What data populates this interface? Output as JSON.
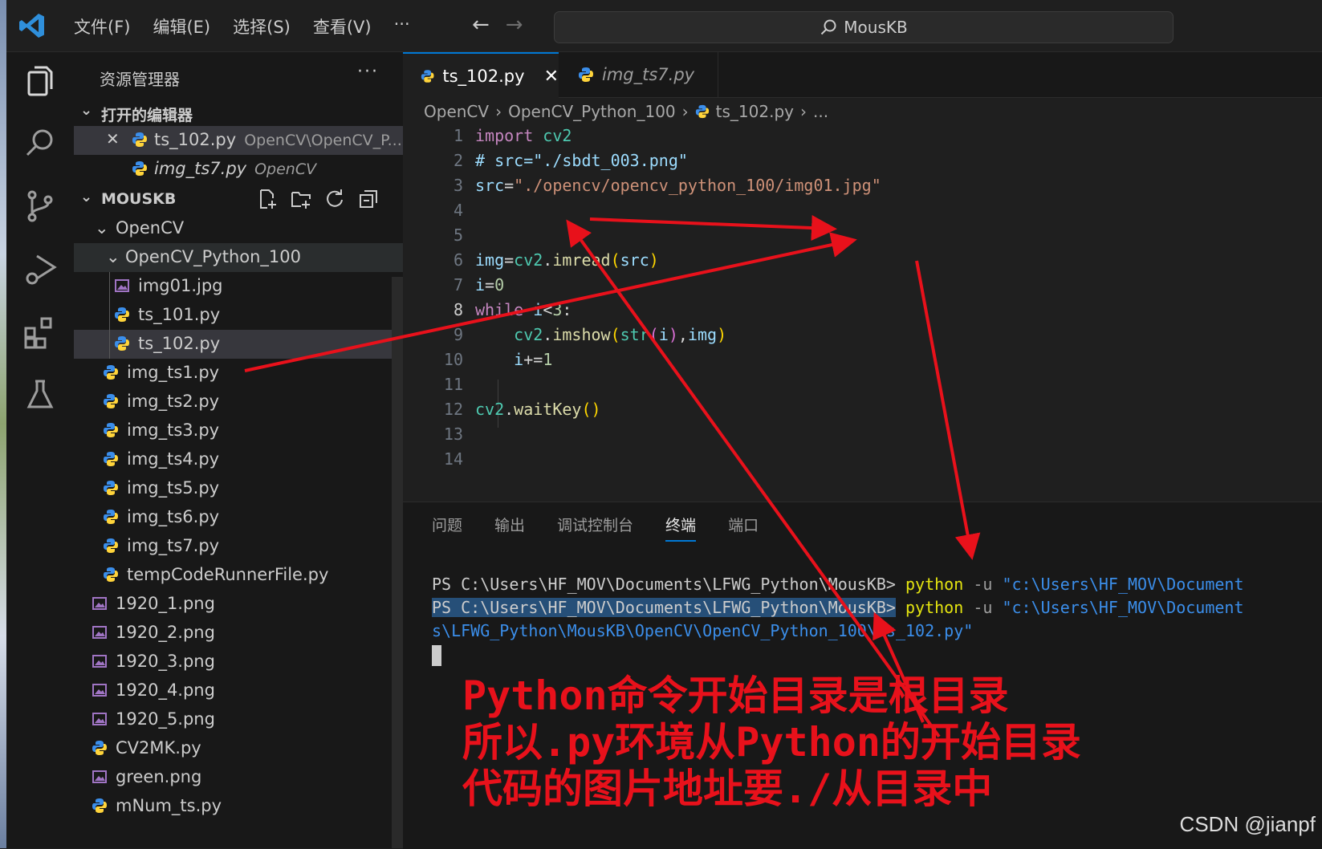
{
  "titlebar": {
    "menu": [
      "文件(F)",
      "编辑(E)",
      "选择(S)",
      "查看(V)",
      "···"
    ],
    "search_text": "MousKB"
  },
  "sidebar": {
    "title": "资源管理器",
    "more": "···",
    "open_editors": {
      "label": "打开的编辑器",
      "items": [
        {
          "name": "ts_102.py",
          "path": "OpenCV\\OpenCV_P..."
        },
        {
          "name": "img_ts7.py",
          "path": "OpenCV"
        }
      ]
    },
    "workspace": {
      "label": "MOUSKB",
      "folders": [
        "OpenCV",
        "OpenCV_Python_100"
      ],
      "files": [
        "img01.jpg",
        "ts_101.py",
        "ts_102.py",
        "img_ts1.py",
        "img_ts2.py",
        "img_ts3.py",
        "img_ts4.py",
        "img_ts5.py",
        "img_ts6.py",
        "img_ts7.py",
        "tempCodeRunnerFile.py",
        "1920_1.png",
        "1920_2.png",
        "1920_3.png",
        "1920_4.png",
        "1920_5.png",
        "CV2MK.py",
        "green.png",
        "mNum_ts.py"
      ]
    }
  },
  "editor": {
    "tabs": [
      {
        "label": "ts_102.py",
        "close": "✕"
      },
      {
        "label": "img_ts7.py"
      }
    ],
    "breadcrumbs": [
      "OpenCV",
      "OpenCV_Python_100",
      "ts_102.py",
      "..."
    ],
    "line_numbers": [
      "1",
      "2",
      "3",
      "4",
      "5",
      "6",
      "7",
      "8",
      "9",
      "10",
      "11",
      "12",
      "13",
      "14"
    ]
  },
  "panel": {
    "tabs": [
      "问题",
      "输出",
      "调试控制台",
      "终端",
      "端口"
    ],
    "terminal": {
      "prompt": "PS C:\\Users\\HF_MOV\\Documents\\LFWG_Python\\MousKB>",
      "cmd": "python",
      "opt": "-u",
      "arg1": "\"c:\\Users\\HF_MOV\\Document",
      "arg2": "s\\LFWG_Python\\MousKB\\OpenCV\\OpenCV_Python_100\\ts_102.py\""
    }
  },
  "annotation": {
    "line1": "Python命令开始目录是根目录",
    "line2": "所以.py环境从Python的开始目录",
    "line3": "代码的图片地址要./从目录中"
  },
  "watermark": "CSDN @jianpf",
  "colors": {
    "accent": "#0078d4",
    "annotation": "#e8111b",
    "background": "#1e1e1e"
  }
}
